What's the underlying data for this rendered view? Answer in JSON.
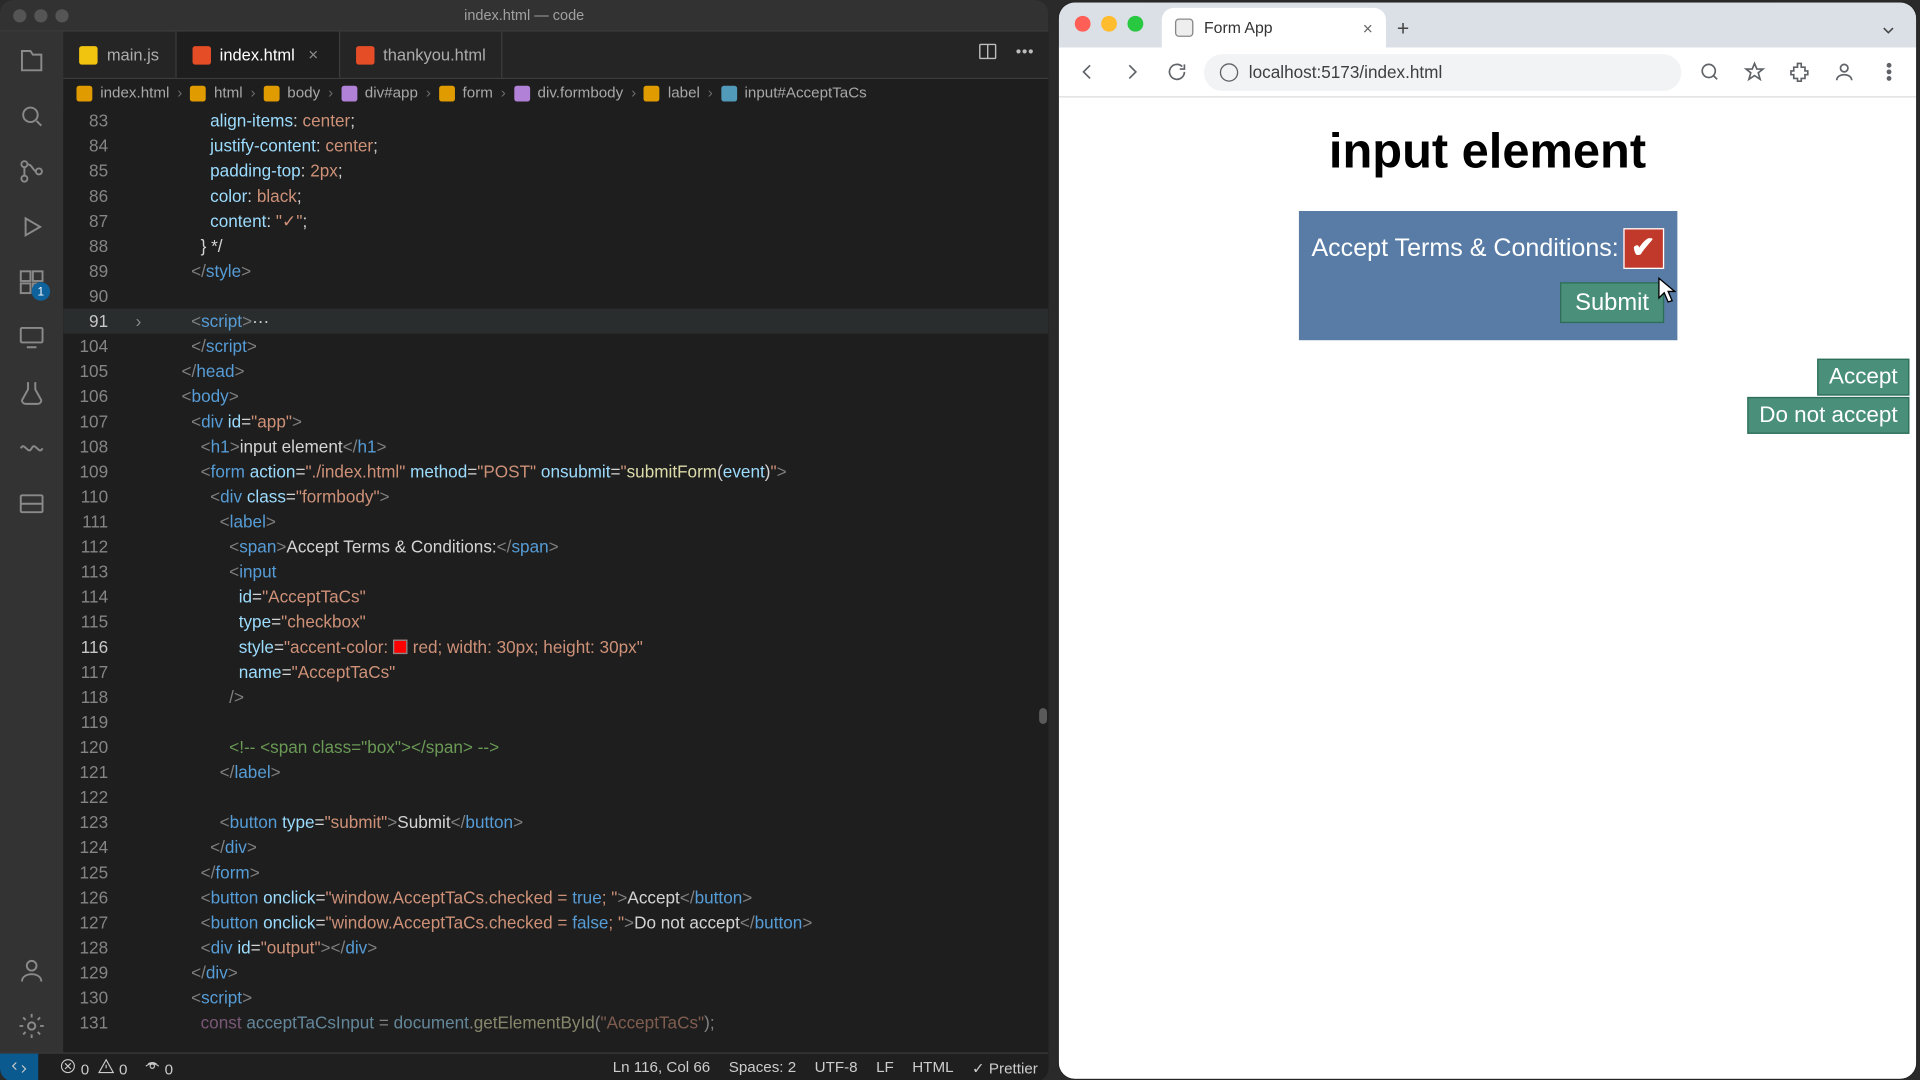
{
  "vscode": {
    "window_title": "index.html — code",
    "tabs": [
      {
        "label": "main.js",
        "icon": "js"
      },
      {
        "label": "index.html",
        "icon": "html",
        "active": true,
        "closeable": true
      },
      {
        "label": "thankyou.html",
        "icon": "html"
      }
    ],
    "breadcrumbs": [
      "index.html",
      "html",
      "body",
      "div#app",
      "form",
      "div.formbody",
      "label",
      "input#AcceptTaCs"
    ],
    "ext_badge": "1",
    "fold": {
      "line": 91,
      "glyph": "›"
    },
    "code_lines": [
      {
        "n": 83,
        "html": "            <span class='a'>align-items</span><span class='x'>: </span><span class='s'>center</span><span class='x'>;</span>"
      },
      {
        "n": 84,
        "html": "            <span class='a'>justify-content</span><span class='x'>: </span><span class='s'>center</span><span class='x'>;</span>"
      },
      {
        "n": 85,
        "html": "            <span class='a'>padding-top</span><span class='x'>: </span><span class='s'>2px</span><span class='x'>;</span>"
      },
      {
        "n": 86,
        "html": "            <span class='a'>color</span><span class='x'>: </span><span class='s'>black</span><span class='x'>;</span>"
      },
      {
        "n": 87,
        "html": "            <span class='a'>content</span><span class='x'>: </span><span class='s'>\"✓\"</span><span class='x'>;</span>"
      },
      {
        "n": 88,
        "html": "          <span class='x'>} */</span>"
      },
      {
        "n": 89,
        "html": "        <span class='p'>&lt;/</span><span class='t'>style</span><span class='p'>&gt;</span>"
      },
      {
        "n": 90,
        "html": ""
      },
      {
        "n": 91,
        "html": "        <span class='p'>&lt;</span><span class='t'>script</span><span class='p'>&gt;</span><span class='x'>···</span>",
        "hl": true,
        "fold": true
      },
      {
        "n": 104,
        "html": "        <span class='p'>&lt;/</span><span class='t'>script</span><span class='p'>&gt;</span>"
      },
      {
        "n": 105,
        "html": "      <span class='p'>&lt;/</span><span class='t'>head</span><span class='p'>&gt;</span>"
      },
      {
        "n": 106,
        "html": "      <span class='p'>&lt;</span><span class='t'>body</span><span class='p'>&gt;</span>"
      },
      {
        "n": 107,
        "html": "        <span class='p'>&lt;</span><span class='t'>div</span> <span class='a'>id</span><span class='x'>=</span><span class='s'>\"app\"</span><span class='p'>&gt;</span>"
      },
      {
        "n": 108,
        "html": "          <span class='p'>&lt;</span><span class='t'>h1</span><span class='p'>&gt;</span><span class='x'>input element</span><span class='p'>&lt;/</span><span class='t'>h1</span><span class='p'>&gt;</span>"
      },
      {
        "n": 109,
        "html": "          <span class='p'>&lt;</span><span class='t'>form</span> <span class='a'>action</span><span class='x'>=</span><span class='s'>\"./index.html\"</span> <span class='a'>method</span><span class='x'>=</span><span class='s'>\"POST\"</span> <span class='a'>onsubmit</span><span class='x'>=</span><span class='s'>\"</span><span class='f'>submitForm</span><span class='x'>(</span><span class='a'>event</span><span class='x'>)</span><span class='s'>\"</span><span class='p'>&gt;</span>"
      },
      {
        "n": 110,
        "html": "            <span class='p'>&lt;</span><span class='t'>div</span> <span class='a'>class</span><span class='x'>=</span><span class='s'>\"formbody\"</span><span class='p'>&gt;</span>"
      },
      {
        "n": 111,
        "html": "              <span class='p'>&lt;</span><span class='t'>label</span><span class='p'>&gt;</span>"
      },
      {
        "n": 112,
        "html": "                <span class='p'>&lt;</span><span class='t'>span</span><span class='p'>&gt;</span><span class='x'>Accept Terms &amp; Conditions:</span><span class='p'>&lt;/</span><span class='t'>span</span><span class='p'>&gt;</span>"
      },
      {
        "n": 113,
        "html": "                <span class='p'>&lt;</span><span class='t'>input</span>"
      },
      {
        "n": 114,
        "html": "                  <span class='a'>id</span><span class='x'>=</span><span class='s'>\"AcceptTaCs\"</span>"
      },
      {
        "n": 115,
        "html": "                  <span class='a'>type</span><span class='x'>=</span><span class='s'>\"checkbox\"</span>"
      },
      {
        "n": 116,
        "html": "                  <span class='a'>style</span><span class='x'>=</span><span class='s'>\"accent-color: </span><span class='sw'></span><span class='s'>red; width: 30px; height: 30px\"</span>",
        "current": true
      },
      {
        "n": 117,
        "html": "                  <span class='a'>name</span><span class='x'>=</span><span class='s'>\"AcceptTaCs\"</span>"
      },
      {
        "n": 118,
        "html": "                <span class='p'>/&gt;</span>"
      },
      {
        "n": 119,
        "html": ""
      },
      {
        "n": 120,
        "html": "                <span class='c'>&lt;!-- &lt;span class=\"box\"&gt;&lt;/span&gt; --&gt;</span>"
      },
      {
        "n": 121,
        "html": "              <span class='p'>&lt;/</span><span class='t'>label</span><span class='p'>&gt;</span>"
      },
      {
        "n": 122,
        "html": ""
      },
      {
        "n": 123,
        "html": "              <span class='p'>&lt;</span><span class='t'>button</span> <span class='a'>type</span><span class='x'>=</span><span class='s'>\"submit\"</span><span class='p'>&gt;</span><span class='x'>Submit</span><span class='p'>&lt;/</span><span class='t'>button</span><span class='p'>&gt;</span>"
      },
      {
        "n": 124,
        "html": "            <span class='p'>&lt;/</span><span class='t'>div</span><span class='p'>&gt;</span>"
      },
      {
        "n": 125,
        "html": "          <span class='p'>&lt;/</span><span class='t'>form</span><span class='p'>&gt;</span>"
      },
      {
        "n": 126,
        "html": "          <span class='p'>&lt;</span><span class='t'>button</span> <span class='a'>onclick</span><span class='x'>=</span><span class='s'>\"window.AcceptTaCs.checked = </span><span class='b'>true</span><span class='s'>; \"</span><span class='p'>&gt;</span><span class='x'>Accept</span><span class='p'>&lt;/</span><span class='t'>button</span><span class='p'>&gt;</span>"
      },
      {
        "n": 127,
        "html": "          <span class='p'>&lt;</span><span class='t'>button</span> <span class='a'>onclick</span><span class='x'>=</span><span class='s'>\"window.AcceptTaCs.checked = </span><span class='b'>false</span><span class='s'>; \"</span><span class='p'>&gt;</span><span class='x'>Do not accept</span><span class='p'>&lt;/</span><span class='t'>button</span><span class='p'>&gt;</span>"
      },
      {
        "n": 128,
        "html": "          <span class='p'>&lt;</span><span class='t'>div</span> <span class='a'>id</span><span class='x'>=</span><span class='s'>\"output\"</span><span class='p'>&gt;&lt;/</span><span class='t'>div</span><span class='p'>&gt;</span>"
      },
      {
        "n": 129,
        "html": "        <span class='p'>&lt;/</span><span class='t'>div</span><span class='p'>&gt;</span>"
      },
      {
        "n": 130,
        "html": "        <span class='p'>&lt;</span><span class='t'>script</span><span class='p'>&gt;</span>"
      },
      {
        "n": 131,
        "html": "          <span class='k'>const</span> <span class='a'>acceptTaCsInput</span> <span class='x'>=</span> <span class='a'>document</span><span class='x'>.</span><span class='f'>getElementById</span><span class='x'>(</span><span class='s'>\"AcceptTaCs\"</span><span class='x'>);</span>",
        "dim": true
      }
    ],
    "status": {
      "errors": "0",
      "warnings": "0",
      "ports": "0",
      "cursor": "Ln 116, Col 66",
      "spaces": "Spaces: 2",
      "encoding": "UTF-8",
      "eol": "LF",
      "lang": "HTML",
      "formatter": "Prettier"
    }
  },
  "chrome": {
    "tab_title": "Form App",
    "url": "localhost:5173/index.html",
    "page": {
      "heading": "input element",
      "label": "Accept Terms & Conditions:",
      "checkbox_checked": true,
      "submit": "Submit",
      "accept": "Accept",
      "do_not_accept": "Do not accept"
    }
  }
}
